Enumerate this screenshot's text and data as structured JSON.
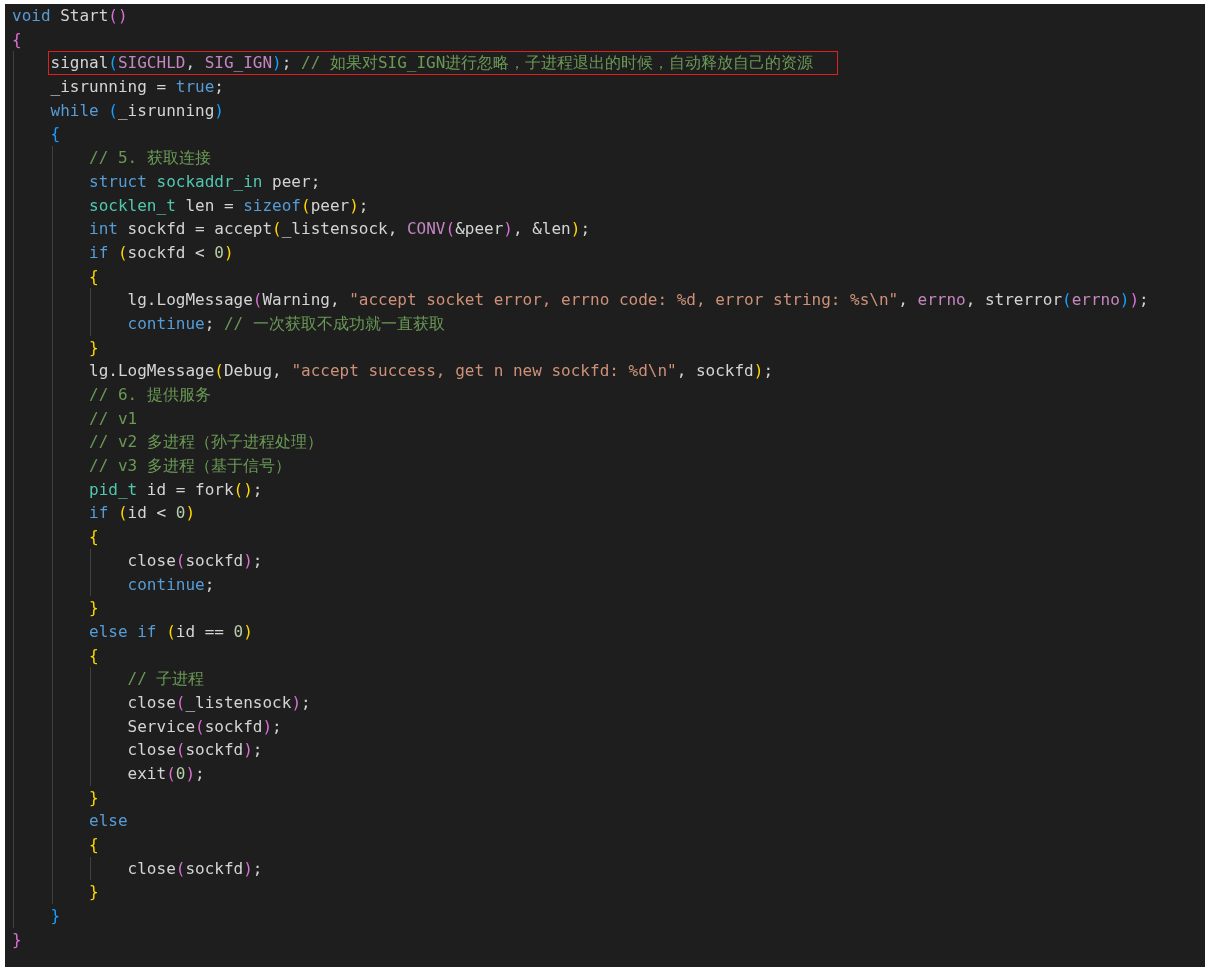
{
  "editor": {
    "lines": [
      {
        "boxed": false,
        "tokens": [
          {
            "kind": "keyword",
            "text": "void"
          },
          {
            "kind": "plain",
            "text": " Start"
          },
          {
            "kind": "bracket2",
            "text": "()"
          }
        ]
      },
      {
        "boxed": false,
        "tokens": [
          {
            "kind": "bracket2",
            "text": "{"
          }
        ],
        "children": [
          {
            "boxed": true,
            "tokens": [
              {
                "kind": "plain",
                "text": "signal"
              },
              {
                "kind": "bracket3",
                "text": "("
              },
              {
                "kind": "macro",
                "text": "SIGCHLD"
              },
              {
                "kind": "plain",
                "text": ", "
              },
              {
                "kind": "macro",
                "text": "SIG_IGN"
              },
              {
                "kind": "bracket3",
                "text": ")"
              },
              {
                "kind": "plain",
                "text": "; "
              },
              {
                "kind": "comment",
                "text": "// 如果对SIG_IGN进行忽略，子进程退出的时候，自动释放自己的资源"
              }
            ]
          },
          {
            "boxed": false,
            "tokens": [
              {
                "kind": "plain",
                "text": "_isrunning = "
              },
              {
                "kind": "keyword",
                "text": "true"
              },
              {
                "kind": "plain",
                "text": ";"
              }
            ]
          },
          {
            "boxed": false,
            "tokens": [
              {
                "kind": "keyword",
                "text": "while "
              },
              {
                "kind": "bracket3",
                "text": "("
              },
              {
                "kind": "plain",
                "text": "_isrunning"
              },
              {
                "kind": "bracket3",
                "text": ")"
              }
            ]
          },
          {
            "boxed": false,
            "tokens": [
              {
                "kind": "bracket3",
                "text": "{"
              }
            ],
            "children": [
              {
                "boxed": false,
                "tokens": [
                  {
                    "kind": "comment",
                    "text": "// 5. 获取连接"
                  }
                ]
              },
              {
                "boxed": false,
                "tokens": [
                  {
                    "kind": "keyword",
                    "text": "struct "
                  },
                  {
                    "kind": "type",
                    "text": "sockaddr_in"
                  },
                  {
                    "kind": "plain",
                    "text": " peer;"
                  }
                ]
              },
              {
                "boxed": false,
                "tokens": [
                  {
                    "kind": "type",
                    "text": "socklen_t"
                  },
                  {
                    "kind": "plain",
                    "text": " len = "
                  },
                  {
                    "kind": "keyword",
                    "text": "sizeof"
                  },
                  {
                    "kind": "bracket1",
                    "text": "("
                  },
                  {
                    "kind": "plain",
                    "text": "peer"
                  },
                  {
                    "kind": "bracket1",
                    "text": ")"
                  },
                  {
                    "kind": "plain",
                    "text": ";"
                  }
                ]
              },
              {
                "boxed": false,
                "tokens": [
                  {
                    "kind": "keyword",
                    "text": "int"
                  },
                  {
                    "kind": "plain",
                    "text": " sockfd = accept"
                  },
                  {
                    "kind": "bracket1",
                    "text": "("
                  },
                  {
                    "kind": "plain",
                    "text": "_listensock, "
                  },
                  {
                    "kind": "macro",
                    "text": "CONV"
                  },
                  {
                    "kind": "bracket2",
                    "text": "("
                  },
                  {
                    "kind": "plain",
                    "text": "&peer"
                  },
                  {
                    "kind": "bracket2",
                    "text": ")"
                  },
                  {
                    "kind": "plain",
                    "text": ", &len"
                  },
                  {
                    "kind": "bracket1",
                    "text": ")"
                  },
                  {
                    "kind": "plain",
                    "text": ";"
                  }
                ]
              },
              {
                "boxed": false,
                "tokens": [
                  {
                    "kind": "keyword",
                    "text": "if "
                  },
                  {
                    "kind": "bracket1",
                    "text": "("
                  },
                  {
                    "kind": "plain",
                    "text": "sockfd < "
                  },
                  {
                    "kind": "number",
                    "text": "0"
                  },
                  {
                    "kind": "bracket1",
                    "text": ")"
                  }
                ]
              },
              {
                "boxed": false,
                "tokens": [
                  {
                    "kind": "bracket1",
                    "text": "{"
                  }
                ],
                "children": [
                  {
                    "boxed": false,
                    "tokens": [
                      {
                        "kind": "plain",
                        "text": "lg.LogMessage"
                      },
                      {
                        "kind": "bracket2",
                        "text": "("
                      },
                      {
                        "kind": "plain",
                        "text": "Warning, "
                      },
                      {
                        "kind": "string",
                        "text": "\"accept socket error, errno code: %d, error string: %s\\n\""
                      },
                      {
                        "kind": "plain",
                        "text": ", "
                      },
                      {
                        "kind": "macro",
                        "text": "errno"
                      },
                      {
                        "kind": "plain",
                        "text": ", strerror"
                      },
                      {
                        "kind": "bracket3",
                        "text": "("
                      },
                      {
                        "kind": "macro",
                        "text": "errno"
                      },
                      {
                        "kind": "bracket3",
                        "text": ")"
                      },
                      {
                        "kind": "bracket2",
                        "text": ")"
                      },
                      {
                        "kind": "plain",
                        "text": ";"
                      }
                    ]
                  },
                  {
                    "boxed": false,
                    "tokens": [
                      {
                        "kind": "keyword",
                        "text": "continue"
                      },
                      {
                        "kind": "plain",
                        "text": "; "
                      },
                      {
                        "kind": "comment",
                        "text": "// 一次获取不成功就一直获取"
                      }
                    ]
                  }
                ]
              },
              {
                "boxed": false,
                "tokens": [
                  {
                    "kind": "bracket1",
                    "text": "}"
                  }
                ]
              },
              {
                "boxed": false,
                "tokens": [
                  {
                    "kind": "plain",
                    "text": "lg.LogMessage"
                  },
                  {
                    "kind": "bracket1",
                    "text": "("
                  },
                  {
                    "kind": "plain",
                    "text": "Debug, "
                  },
                  {
                    "kind": "string",
                    "text": "\"accept success, get n new sockfd: %d\\n\""
                  },
                  {
                    "kind": "plain",
                    "text": ", sockfd"
                  },
                  {
                    "kind": "bracket1",
                    "text": ")"
                  },
                  {
                    "kind": "plain",
                    "text": ";"
                  }
                ]
              },
              {
                "boxed": false,
                "tokens": [
                  {
                    "kind": "comment",
                    "text": "// 6. 提供服务"
                  }
                ]
              },
              {
                "boxed": false,
                "tokens": [
                  {
                    "kind": "comment",
                    "text": "// v1"
                  }
                ]
              },
              {
                "boxed": false,
                "tokens": [
                  {
                    "kind": "comment",
                    "text": "// v2 多进程（孙子进程处理）"
                  }
                ]
              },
              {
                "boxed": false,
                "tokens": [
                  {
                    "kind": "comment",
                    "text": "// v3 多进程（基于信号）"
                  }
                ]
              },
              {
                "boxed": false,
                "tokens": [
                  {
                    "kind": "type",
                    "text": "pid_t"
                  },
                  {
                    "kind": "plain",
                    "text": " id = fork"
                  },
                  {
                    "kind": "bracket1",
                    "text": "()"
                  },
                  {
                    "kind": "plain",
                    "text": ";"
                  }
                ]
              },
              {
                "boxed": false,
                "tokens": [
                  {
                    "kind": "keyword",
                    "text": "if "
                  },
                  {
                    "kind": "bracket1",
                    "text": "("
                  },
                  {
                    "kind": "plain",
                    "text": "id < "
                  },
                  {
                    "kind": "number",
                    "text": "0"
                  },
                  {
                    "kind": "bracket1",
                    "text": ")"
                  }
                ]
              },
              {
                "boxed": false,
                "tokens": [
                  {
                    "kind": "bracket1",
                    "text": "{"
                  }
                ],
                "children": [
                  {
                    "boxed": false,
                    "tokens": [
                      {
                        "kind": "plain",
                        "text": "close"
                      },
                      {
                        "kind": "bracket2",
                        "text": "("
                      },
                      {
                        "kind": "plain",
                        "text": "sockfd"
                      },
                      {
                        "kind": "bracket2",
                        "text": ")"
                      },
                      {
                        "kind": "plain",
                        "text": ";"
                      }
                    ]
                  },
                  {
                    "boxed": false,
                    "tokens": [
                      {
                        "kind": "keyword",
                        "text": "continue"
                      },
                      {
                        "kind": "plain",
                        "text": ";"
                      }
                    ]
                  }
                ]
              },
              {
                "boxed": false,
                "tokens": [
                  {
                    "kind": "bracket1",
                    "text": "}"
                  }
                ]
              },
              {
                "boxed": false,
                "tokens": [
                  {
                    "kind": "keyword",
                    "text": "else if "
                  },
                  {
                    "kind": "bracket1",
                    "text": "("
                  },
                  {
                    "kind": "plain",
                    "text": "id == "
                  },
                  {
                    "kind": "number",
                    "text": "0"
                  },
                  {
                    "kind": "bracket1",
                    "text": ")"
                  }
                ]
              },
              {
                "boxed": false,
                "tokens": [
                  {
                    "kind": "bracket1",
                    "text": "{"
                  }
                ],
                "children": [
                  {
                    "boxed": false,
                    "tokens": [
                      {
                        "kind": "comment",
                        "text": "// 子进程"
                      }
                    ]
                  },
                  {
                    "boxed": false,
                    "tokens": [
                      {
                        "kind": "plain",
                        "text": "close"
                      },
                      {
                        "kind": "bracket2",
                        "text": "("
                      },
                      {
                        "kind": "plain",
                        "text": "_listensock"
                      },
                      {
                        "kind": "bracket2",
                        "text": ")"
                      },
                      {
                        "kind": "plain",
                        "text": ";"
                      }
                    ]
                  },
                  {
                    "boxed": false,
                    "tokens": [
                      {
                        "kind": "plain",
                        "text": "Service"
                      },
                      {
                        "kind": "bracket2",
                        "text": "("
                      },
                      {
                        "kind": "plain",
                        "text": "sockfd"
                      },
                      {
                        "kind": "bracket2",
                        "text": ")"
                      },
                      {
                        "kind": "plain",
                        "text": ";"
                      }
                    ]
                  },
                  {
                    "boxed": false,
                    "tokens": [
                      {
                        "kind": "plain",
                        "text": "close"
                      },
                      {
                        "kind": "bracket2",
                        "text": "("
                      },
                      {
                        "kind": "plain",
                        "text": "sockfd"
                      },
                      {
                        "kind": "bracket2",
                        "text": ")"
                      },
                      {
                        "kind": "plain",
                        "text": ";"
                      }
                    ]
                  },
                  {
                    "boxed": false,
                    "tokens": [
                      {
                        "kind": "plain",
                        "text": "exit"
                      },
                      {
                        "kind": "bracket2",
                        "text": "("
                      },
                      {
                        "kind": "number",
                        "text": "0"
                      },
                      {
                        "kind": "bracket2",
                        "text": ")"
                      },
                      {
                        "kind": "plain",
                        "text": ";"
                      }
                    ]
                  }
                ]
              },
              {
                "boxed": false,
                "tokens": [
                  {
                    "kind": "bracket1",
                    "text": "}"
                  }
                ]
              },
              {
                "boxed": false,
                "tokens": [
                  {
                    "kind": "keyword",
                    "text": "else"
                  }
                ]
              },
              {
                "boxed": false,
                "tokens": [
                  {
                    "kind": "bracket1",
                    "text": "{"
                  }
                ],
                "children": [
                  {
                    "boxed": false,
                    "tokens": [
                      {
                        "kind": "plain",
                        "text": "close"
                      },
                      {
                        "kind": "bracket2",
                        "text": "("
                      },
                      {
                        "kind": "plain",
                        "text": "sockfd"
                      },
                      {
                        "kind": "bracket2",
                        "text": ")"
                      },
                      {
                        "kind": "plain",
                        "text": ";"
                      }
                    ]
                  }
                ]
              },
              {
                "boxed": false,
                "tokens": [
                  {
                    "kind": "bracket1",
                    "text": "}"
                  }
                ]
              }
            ]
          },
          {
            "boxed": false,
            "tokens": [
              {
                "kind": "bracket3",
                "text": "}"
              }
            ]
          }
        ]
      },
      {
        "boxed": false,
        "tokens": [
          {
            "kind": "bracket2",
            "text": "}"
          }
        ]
      }
    ]
  }
}
